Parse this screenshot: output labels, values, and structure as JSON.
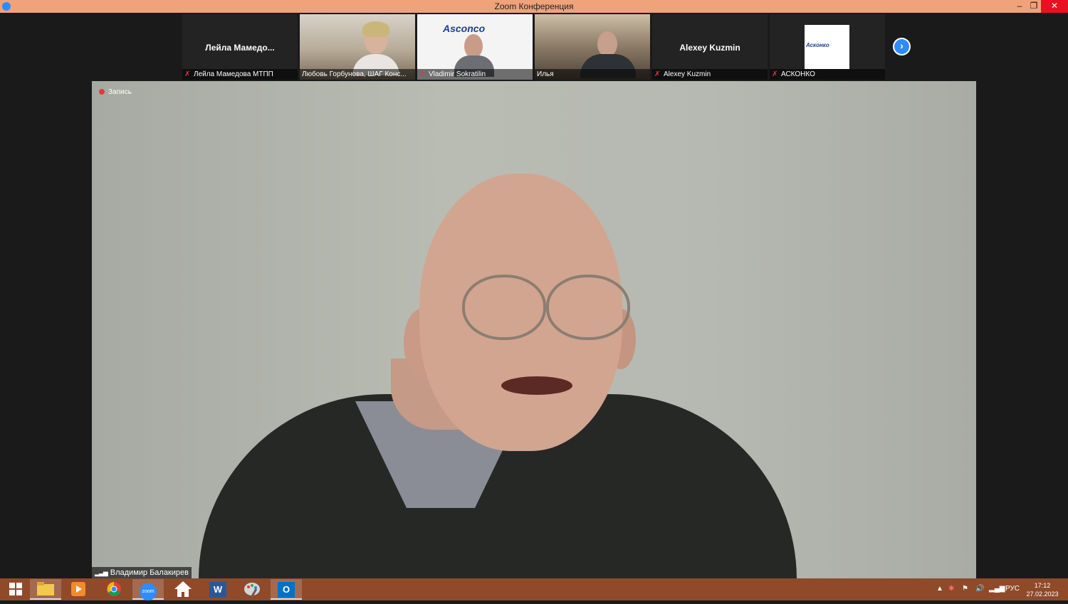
{
  "window": {
    "title": "Zoom Конференция",
    "minimize_glyph": "–",
    "maximize_glyph": "❐",
    "close_glyph": "✕"
  },
  "participants": [
    {
      "name": "Лейла Мамедова МТПП",
      "display": "Лейла  Мамедо...",
      "muted": true,
      "video": false
    },
    {
      "name": "Любовь  Горбунова, ШАГ Конс...",
      "muted": false,
      "video": true
    },
    {
      "name": "Vladimir Sokratilin",
      "muted": true,
      "video": true,
      "logo": "Asconco"
    },
    {
      "name": "Илья",
      "muted": false,
      "video": true
    },
    {
      "name": "Alexey Kuzmin",
      "display": "Alexey Kuzmin",
      "muted": true,
      "video": false
    },
    {
      "name": "АСКОНКО",
      "muted": true,
      "video": false,
      "logo": "Асконко"
    }
  ],
  "next_page_glyph": "›",
  "main": {
    "recording_label": "Запись",
    "speaker_name": "Владимир Балакирев",
    "signal_icon": "signal-bars-icon"
  },
  "taskbar": {
    "items": [
      "windows-start-icon",
      "file-explorer-icon",
      "media-player-icon",
      "chrome-icon",
      "zoom-icon",
      "home-icon",
      "word-icon",
      "paint-icon",
      "outlook-icon"
    ],
    "zoom_label": "zoom",
    "word_label": "W",
    "outlook_label": "O",
    "tray_arrow": "▲",
    "language": "РУС",
    "time": "17:12",
    "date": "27.02.2023"
  },
  "colors": {
    "titlebar": "#f0a27a",
    "taskbar": "#8f4a2a",
    "zoom_blue": "#2d8cff",
    "muted_red": "#e23b3b"
  }
}
